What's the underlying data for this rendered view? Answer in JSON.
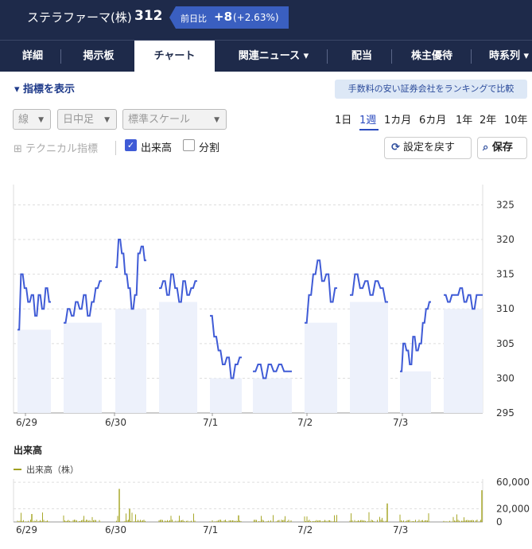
{
  "header": {
    "stock_name": "ステラファーマ(株)",
    "price": "312",
    "change_label": "前日比",
    "change": "+8",
    "change_pct": "(+2.63%)"
  },
  "tabs": [
    {
      "label": "詳細"
    },
    {
      "label": "掲示板"
    },
    {
      "label": "チャート",
      "active": true
    },
    {
      "label": "関連ニュース ▾"
    },
    {
      "label": "配当"
    },
    {
      "label": "株主優待"
    },
    {
      "label": "時系列 ▾"
    }
  ],
  "controls": {
    "indicator_toggle": "▾ 指標を表示",
    "broker_link": "手数料の安い証券会社をランキングで比較",
    "line_type": "線",
    "interval": "日中足",
    "scale": "標準スケール",
    "periods": [
      "1日",
      "1週",
      "1カ月",
      "6カ月",
      "1年",
      "2年",
      "10年"
    ],
    "active_period": "1週",
    "technical": "テクニカル指標",
    "volume_label": "出来高",
    "split_label": "分割",
    "volume_checked": true,
    "split_checked": false,
    "reset_button": "設定を戻す",
    "save_button": "保存"
  },
  "volume_section": {
    "title": "出来高",
    "legend": "出来高（株）"
  },
  "colors": {
    "header_bg": "#1e2a4a",
    "accent": "#3a5fc0",
    "price_line": "#3f5bd6",
    "session_fill": "#edf1fb",
    "volume_bar": "#a8a82a"
  },
  "chart_data": {
    "type": "line",
    "x_labels": [
      "6/29",
      "6/30",
      "7/1",
      "7/2",
      "7/3"
    ],
    "price": {
      "y_ticks": [
        295,
        300,
        305,
        310,
        315,
        320,
        325
      ],
      "ylim": [
        295,
        327
      ],
      "sessions": [
        {
          "label": "6/29",
          "values": [
            307,
            315,
            313,
            311,
            312,
            309,
            312,
            310,
            313,
            311,
            308,
            310,
            309,
            311,
            310,
            312,
            309,
            311,
            313,
            314
          ]
        },
        {
          "label": "6/30",
          "values": [
            316,
            320,
            318,
            315,
            313,
            310,
            312,
            318,
            319,
            317,
            313,
            314,
            312,
            315,
            313,
            311,
            314,
            312,
            313,
            314
          ]
        },
        {
          "label": "7/1",
          "values": [
            309,
            306,
            304,
            302,
            303,
            300,
            302,
            303,
            301,
            302,
            300,
            302,
            301,
            302,
            301,
            301
          ]
        },
        {
          "label": "7/2",
          "values": [
            308,
            312,
            315,
            317,
            314,
            315,
            311,
            313,
            312,
            315,
            313,
            314,
            312,
            314,
            313,
            311
          ]
        },
        {
          "label": "7/3",
          "values": [
            301,
            305,
            304,
            302,
            306,
            304,
            305,
            308,
            310,
            311,
            312,
            311,
            312,
            312,
            313,
            311,
            312,
            310,
            312,
            312
          ]
        }
      ]
    },
    "volume": {
      "y_ticks": [
        0,
        20000,
        60000
      ],
      "y_tick_labels": [
        "0",
        "20,000",
        "60,000"
      ],
      "ylim": [
        0,
        65000
      ],
      "spikes": [
        {
          "session": 0,
          "value": 12000
        },
        {
          "session": 1,
          "value": 50000
        },
        {
          "session": 1,
          "value": 20000
        },
        {
          "session": 3,
          "value": 10000
        },
        {
          "session": 4,
          "value": 28000
        },
        {
          "session": 4,
          "value": 48000
        }
      ]
    }
  }
}
